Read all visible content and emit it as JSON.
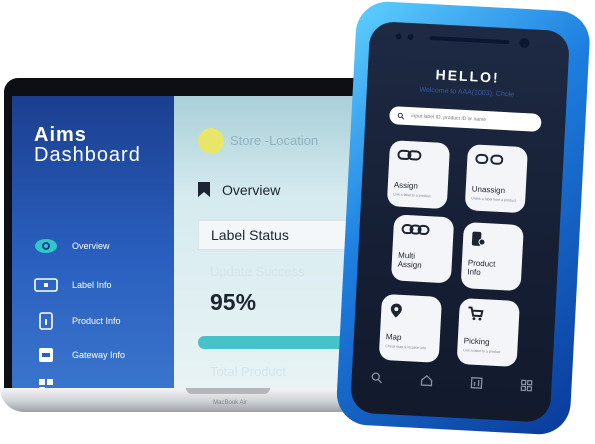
{
  "laptop": {
    "brand_line1": "Aims",
    "brand_line2": "Dashboard",
    "nav": [
      {
        "label": "Overview"
      },
      {
        "label": "Label Info"
      },
      {
        "label": "Product Info"
      },
      {
        "label": "Gateway Info"
      }
    ],
    "store_location": "Store -Location",
    "overview_title": "Overview",
    "label_status": "Label Status",
    "update_success_label": "Update Success",
    "update_success_value": "95%",
    "update_success_progress": 0.95,
    "total_product_label": "Total Product",
    "model_name": "MacBook Air"
  },
  "phone": {
    "hello": "HELLO!",
    "welcome": "Welcome to AAA(1003), Chole",
    "search_placeholder": "input label ID, product ID or name",
    "tiles": [
      {
        "label": "Assign",
        "sub": "Link a label to a product",
        "icon": "link-icon"
      },
      {
        "label": "Unassign",
        "sub": "Unlink a label from a product",
        "icon": "unlink-icon"
      },
      {
        "label": "Multi\nAssign",
        "icon": "multi-link-icon"
      },
      {
        "label": "Product\nInfo",
        "icon": "product-info-icon"
      },
      {
        "label": "Map",
        "sub": "Check map & location info",
        "icon": "map-pin-icon"
      },
      {
        "label": "Picking",
        "sub": "Link a label to a product",
        "icon": "cart-icon"
      }
    ],
    "tabs": [
      {
        "icon": "search-icon"
      },
      {
        "icon": "home-icon"
      },
      {
        "icon": "chart-icon"
      },
      {
        "icon": "grid-icon"
      }
    ]
  },
  "colors": {
    "sidebar": "#1b3f8f",
    "accent_teal": "#47c2c9",
    "phone_frame": "#1d7fe0",
    "phone_bg": "#151e33"
  }
}
